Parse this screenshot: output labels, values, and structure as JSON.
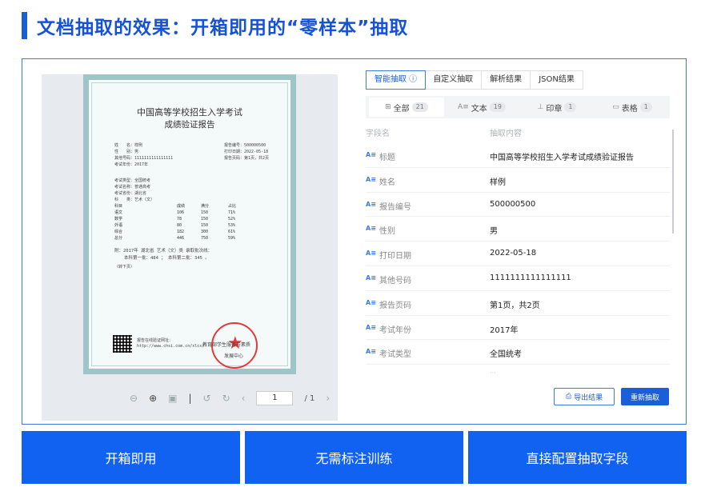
{
  "heading": {
    "title": "文档抽取的效果：开箱即用的“零样本”抽取"
  },
  "preview": {
    "doc": {
      "title": "中国高等学校招生入学考试",
      "subtitle": "成绩验证报告",
      "left_lines": [
        "姓　　名：样例",
        "性　　别：男",
        "其他号码：1111111111111111",
        "考试年份：2017年"
      ],
      "right_lines": [
        "报告编号：500000500",
        "打印日期：2022-05-18",
        "报告页码：第1页，共2页"
      ],
      "mid_lines": [
        "考试类型：全国统考",
        "考试名称：普通高考",
        "考试省份：湖北省",
        "科　　类：艺术（文）"
      ],
      "score_header": [
        "科目",
        "成绩",
        "满分",
        "占比"
      ],
      "scores": [
        [
          "语文",
          "106",
          "150",
          "71%"
        ],
        [
          "数学",
          "78",
          "150",
          "52%"
        ],
        [
          "外语",
          "80",
          "150",
          "53%"
        ],
        [
          "综合",
          "182",
          "300",
          "61%"
        ],
        [
          "总分",
          "446",
          "750",
          "59%"
        ]
      ],
      "note1": "附：2017年 湖北省 艺术（文）类 录取批次线：",
      "note2": "本科第一批：484 ； 本科第二批：345 。",
      "note3": "（转下页）",
      "footer1": "报告在线验证网址：",
      "footer2": "http://www.chsi.com.cn/xlcx/",
      "seal_text1": "教育部学生服务与素质",
      "seal_text2": "发展中心"
    },
    "toolbar": {
      "page": "1",
      "total": "/ 1"
    }
  },
  "panel": {
    "tabs": [
      {
        "label": "智能抽取 ⓘ",
        "active": true
      },
      {
        "label": "自定义抽取",
        "active": false
      },
      {
        "label": "解析结果",
        "active": false
      },
      {
        "label": "JSON结果",
        "active": false
      }
    ],
    "filters": [
      {
        "icon": "⊞",
        "label": "全部",
        "count": "21"
      },
      {
        "icon": "A≡",
        "label": "文本",
        "count": "19"
      },
      {
        "icon": "⊥",
        "label": "印章",
        "count": "1"
      },
      {
        "icon": "▭",
        "label": "表格",
        "count": "1"
      }
    ],
    "table_header": {
      "field": "字段名",
      "content": "抽取内容"
    },
    "ai_glyph": "A≡",
    "rows": [
      {
        "key": "标题",
        "value": "中国高等学校招生入学考试成绩验证报告"
      },
      {
        "key": "姓名",
        "value": "样例"
      },
      {
        "key": "报告编号",
        "value": "500000500"
      },
      {
        "key": "性别",
        "value": "男"
      },
      {
        "key": "打印日期",
        "value": "2022-05-18"
      },
      {
        "key": "其他号码",
        "value": "1111111111111111"
      },
      {
        "key": "报告页码",
        "value": "第1页，共2页"
      },
      {
        "key": "考试年份",
        "value": "2017年"
      },
      {
        "key": "考试类型",
        "value": "全国统考"
      }
    ],
    "more": "···",
    "export_label": "导出结果",
    "retry_label": "重新抽取"
  },
  "cta": [
    "开箱即用",
    "无需标注训练",
    "直接配置抽取字段"
  ]
}
